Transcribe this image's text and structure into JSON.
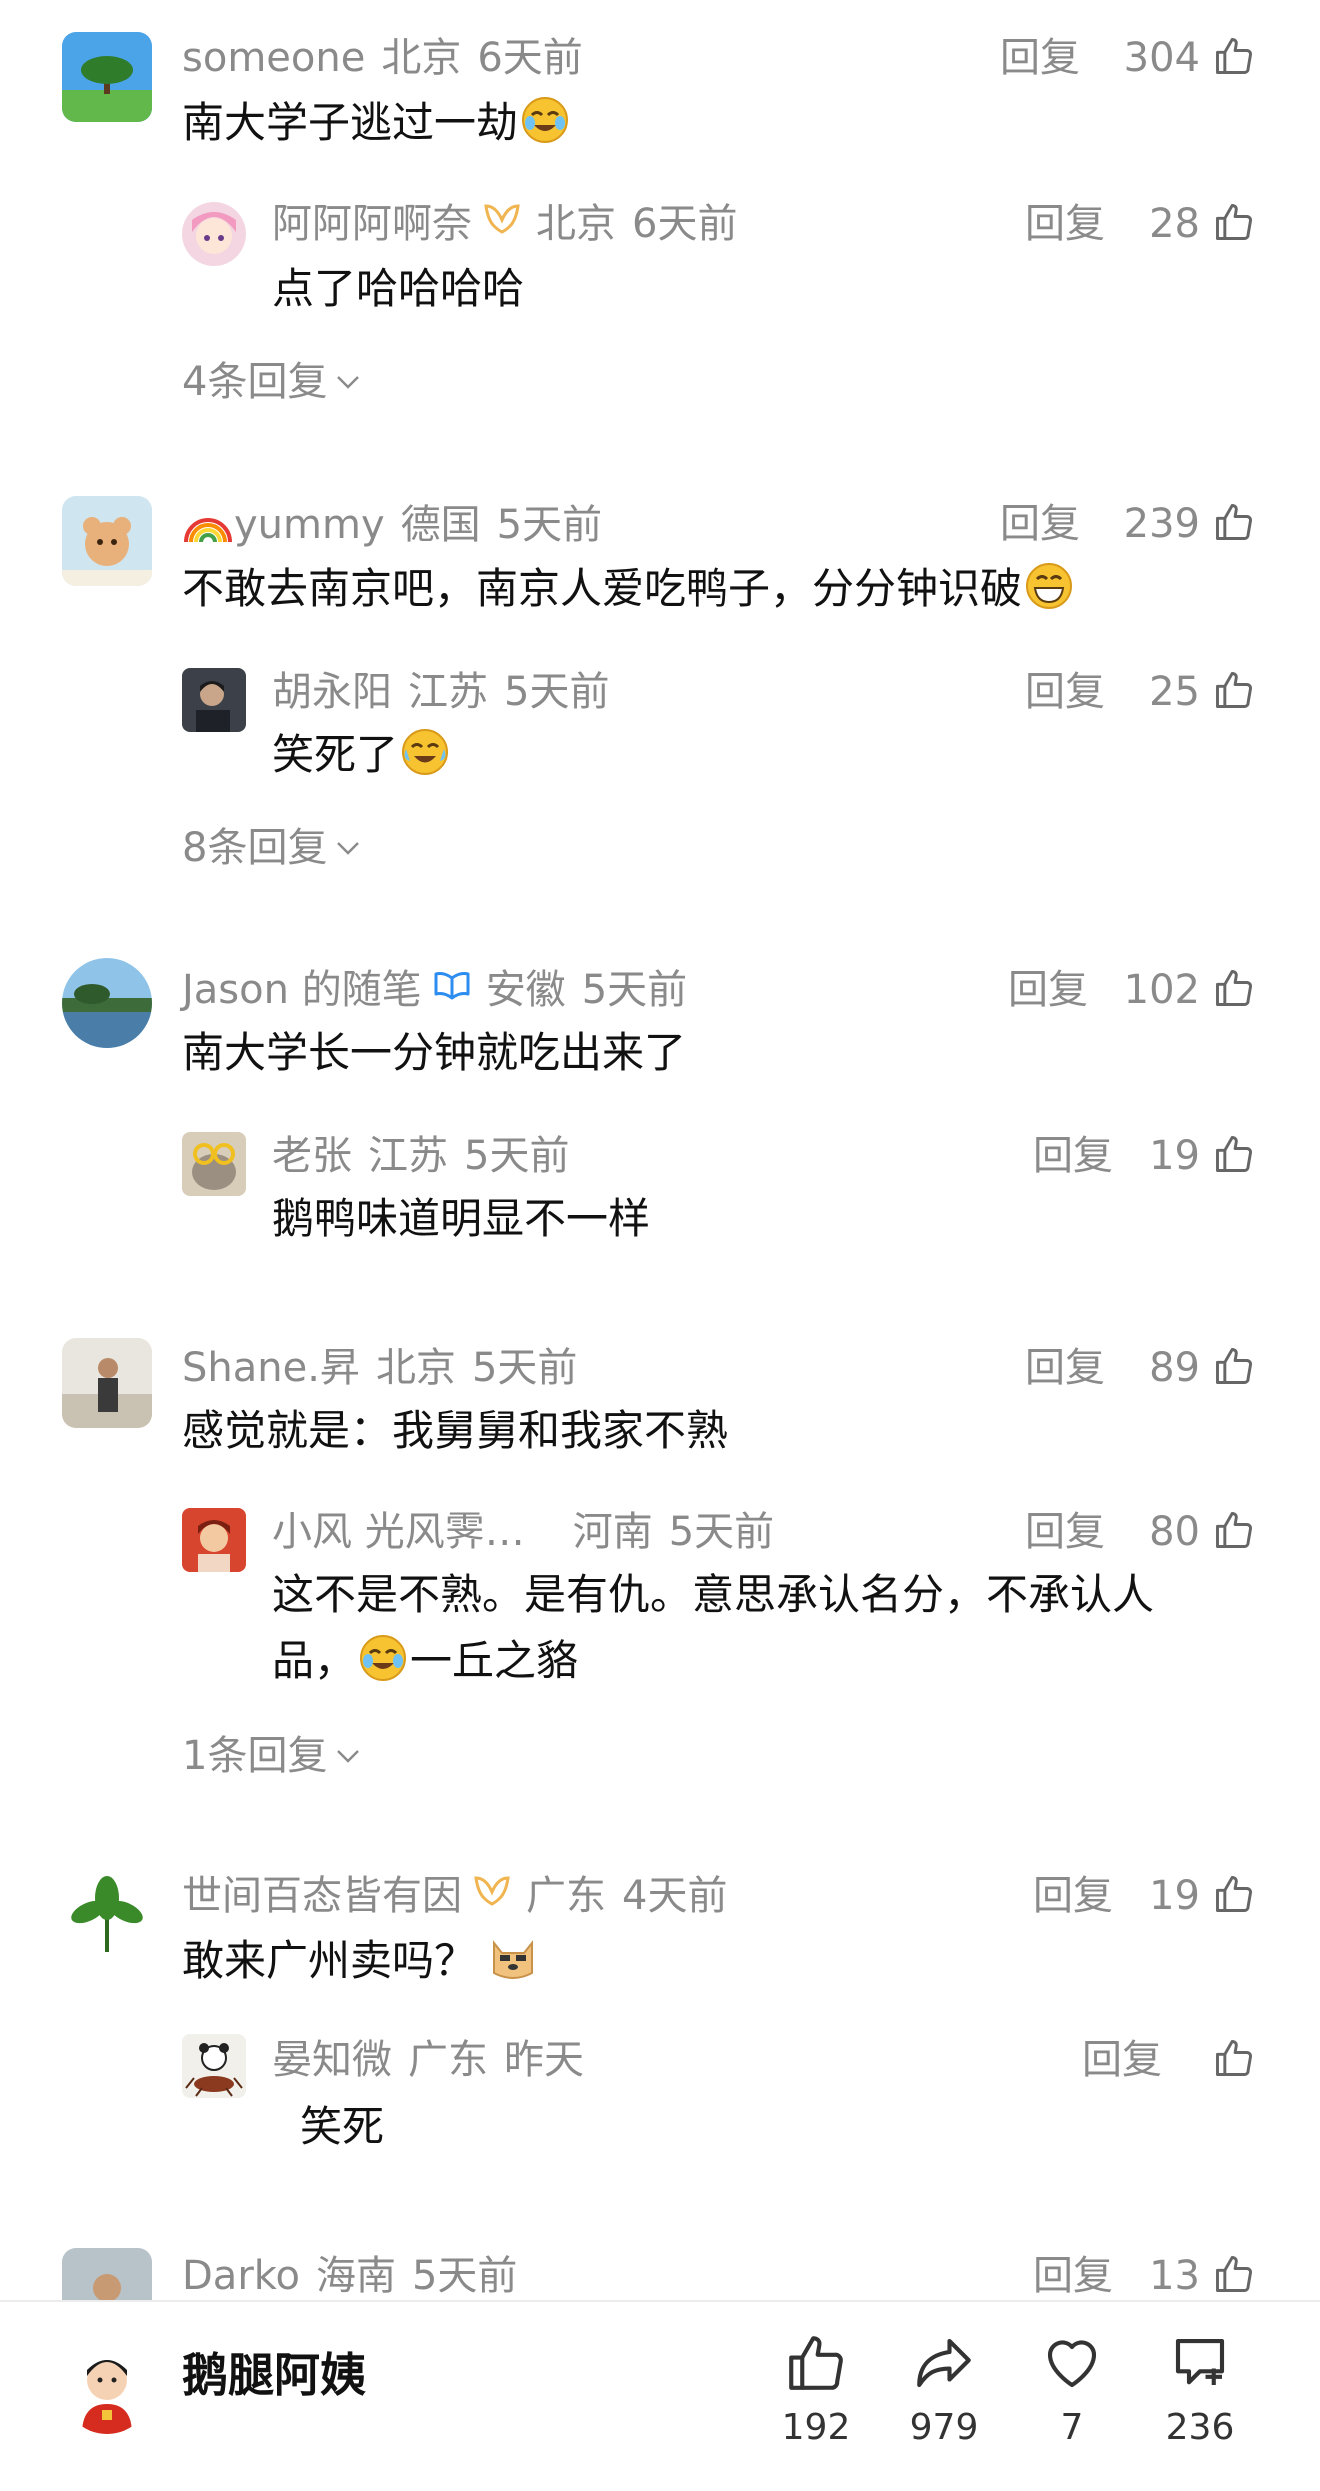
{
  "comments": [
    {
      "user": "someone",
      "location": "北京",
      "time": "6天前",
      "reply_label": "回复",
      "likes": "304",
      "text": "南大学子逃过一劫",
      "emoji_after": "crying-laughing",
      "sub": [
        {
          "user": "阿阿阿啊奈",
          "badge": "gold-vip-icon",
          "location": "北京",
          "time": "6天前",
          "reply_label": "回复",
          "likes": "28",
          "text": "点了哈哈哈哈"
        }
      ],
      "more": "4条回复"
    },
    {
      "user": "yummy",
      "user_prefix_icon": "rainbow",
      "location": "德国",
      "time": "5天前",
      "reply_label": "回复",
      "likes": "239",
      "text": "不敢去南京吧，南京人爱吃鸭子，分分钟识破",
      "emoji_after": "grinning",
      "sub": [
        {
          "user": "胡永阳",
          "location": "江苏",
          "time": "5天前",
          "reply_label": "回复",
          "likes": "25",
          "text": "笑死了",
          "emoji_after": "tears-of-joy"
        }
      ],
      "more": "8条回复"
    },
    {
      "user": "Jason 的随笔",
      "badge": "blue-v-icon",
      "location": "安徽",
      "time": "5天前",
      "reply_label": "回复",
      "likes": "102",
      "text": "南大学长一分钟就吃出来了",
      "sub": [
        {
          "user": "老张",
          "location": "江苏",
          "time": "5天前",
          "reply_label": "回复",
          "likes": "19",
          "text": "鹅鸭味道明显不一样"
        }
      ],
      "more": ""
    },
    {
      "user": "Shane.昇",
      "location": "北京",
      "time": "5天前",
      "reply_label": "回复",
      "likes": "89",
      "text": "感觉就是：我舅舅和我家不熟",
      "sub": [
        {
          "user": "小风 光风霁…",
          "location": "河南",
          "time": "5天前",
          "reply_label": "回复",
          "likes": "80",
          "text": "这不是不熟。是有仇。意思承认名分，不承认人",
          "text_line2_before": "品，",
          "text_line2_after": "一丘之貉"
        }
      ],
      "more": "1条回复"
    },
    {
      "user": "世间百态皆有因",
      "badge": "gold-vip-icon",
      "location": "广东",
      "time": "4天前",
      "reply_label": "回复",
      "likes": "19",
      "text": "敢来广州卖吗？",
      "emoji_after": "doge",
      "sub": [
        {
          "user": "晏知微",
          "location": "广东",
          "time": "昨天",
          "reply_label": "回复",
          "likes": "",
          "text": "笑死"
        }
      ],
      "more": ""
    },
    {
      "user": "Darko",
      "location": "海南",
      "time": "5天前",
      "reply_label": "回复",
      "likes": "13"
    }
  ],
  "bottom_bar": {
    "author": "鹅腿阿姨",
    "actions": [
      {
        "icon": "like-icon",
        "count": "192"
      },
      {
        "icon": "share-icon",
        "count": "979"
      },
      {
        "icon": "heart-icon",
        "count": "7"
      },
      {
        "icon": "comment-icon",
        "count": "236"
      }
    ]
  },
  "colors": {
    "meta_gray": "#8a8a8a",
    "text": "#111111",
    "gold_badge": "#f0b450",
    "blue_badge": "#2d8cf0"
  }
}
